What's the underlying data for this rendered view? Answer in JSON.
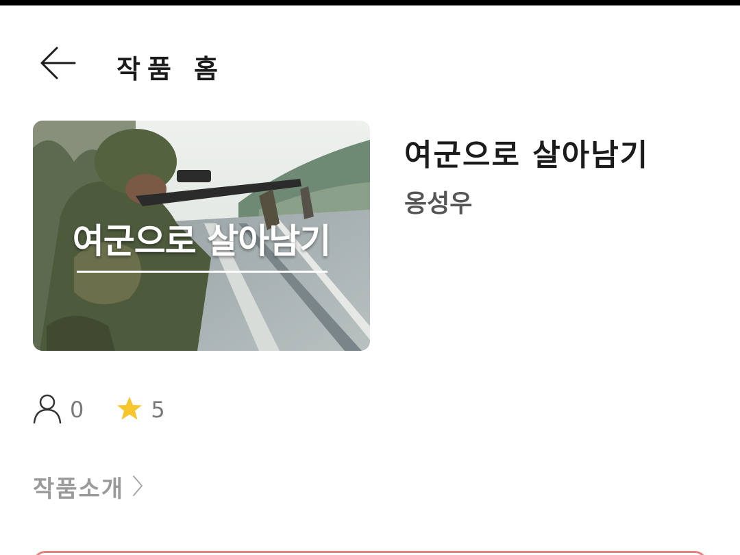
{
  "header": {
    "title": "작품 홈"
  },
  "work": {
    "cover_text": "여군으로 살아남기",
    "title": "여군으로 살아남기",
    "author": "옹성우"
  },
  "stats": {
    "readers": "0",
    "rating": "5"
  },
  "intro": {
    "label": "작품소개"
  },
  "icons": {
    "back": "arrow-left-icon",
    "readers": "person-icon",
    "rating": "star-icon",
    "intro": "chevron-right-icon"
  },
  "colors": {
    "star": "#F7C52C",
    "stat_text": "#7A7A7A",
    "bottom_button_border": "#E2807C"
  }
}
